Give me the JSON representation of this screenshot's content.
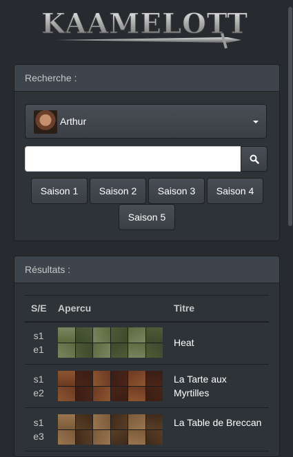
{
  "app": {
    "logo_text": "KAAMELOTT"
  },
  "search_panel": {
    "heading": "Recherche :",
    "character_select": {
      "selected": "Arthur"
    },
    "search": {
      "placeholder": ""
    },
    "seasons": [
      "Saison 1",
      "Saison 2",
      "Saison 3",
      "Saison 4",
      "Saison 5"
    ]
  },
  "results_panel": {
    "heading": "Résultats :",
    "columns": [
      "S/E",
      "Apercu",
      "Titre"
    ],
    "rows": [
      {
        "season": "s1",
        "episode": "e1",
        "title": "Heat",
        "preview_palette": [
          "#5b6a3e",
          "#3b4a2c",
          "#7a8560",
          "#4e5b38"
        ]
      },
      {
        "season": "s1",
        "episode": "e2",
        "title": "La Tarte aux Myrtilles",
        "preview_palette": [
          "#6b3a22",
          "#4a2518",
          "#8e5531",
          "#3a1d14"
        ]
      },
      {
        "season": "s1",
        "episode": "e3",
        "title": "La Table de Breccan",
        "preview_palette": [
          "#7a5a3a",
          "#5a3e26",
          "#9a7550",
          "#3e2a1a"
        ]
      }
    ]
  },
  "colors": {
    "background": "#272b30",
    "panel": "#2e3338",
    "heading": "#3e444c"
  }
}
